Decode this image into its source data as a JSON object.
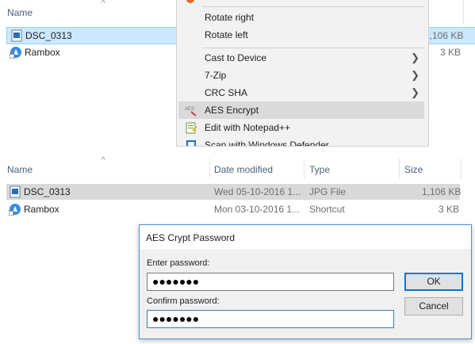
{
  "top_explorer": {
    "col_name": "Name",
    "files": [
      {
        "name": "DSC_0313",
        "size": "1,106 KB",
        "icon": "image-file-icon"
      },
      {
        "name": "Rambox",
        "size": "3 KB",
        "icon": "rambox-shortcut-icon"
      }
    ]
  },
  "context_menu": {
    "items": [
      {
        "label": "Rotate right"
      },
      {
        "label": "Rotate left"
      },
      {
        "label": "Cast to Device",
        "submenu": true
      },
      {
        "label": "7-Zip",
        "submenu": true
      },
      {
        "label": "CRC SHA",
        "submenu": true
      },
      {
        "label": "AES Encrypt",
        "icon": "aes-crypt-icon"
      },
      {
        "label": "Edit with Notepad++",
        "icon": "notepadpp-icon"
      },
      {
        "label": "Scan with Windows Defender",
        "icon": "defender-icon"
      }
    ]
  },
  "explorer": {
    "columns": {
      "name": "Name",
      "date": "Date modified",
      "type": "Type",
      "size": "Size"
    },
    "rows": [
      {
        "name": "DSC_0313",
        "date": "Wed 05-10-2016 1...",
        "type": "JPG File",
        "size": "1,106 KB"
      },
      {
        "name": "Rambox",
        "date": "Mon 03-10-2016 1...",
        "type": "Shortcut",
        "size": "3 KB"
      }
    ]
  },
  "dialog": {
    "title": "AES Crypt Password",
    "enter_label": "Enter password:",
    "enter_value": "●●●●●●●",
    "confirm_label": "Confirm password:",
    "confirm_value": "●●●●●●●",
    "ok_label": "OK",
    "cancel_label": "Cancel"
  },
  "colors": {
    "selection": "#cce8ff",
    "selection_gray": "#d9d9d9",
    "accent": "#0078d7"
  }
}
